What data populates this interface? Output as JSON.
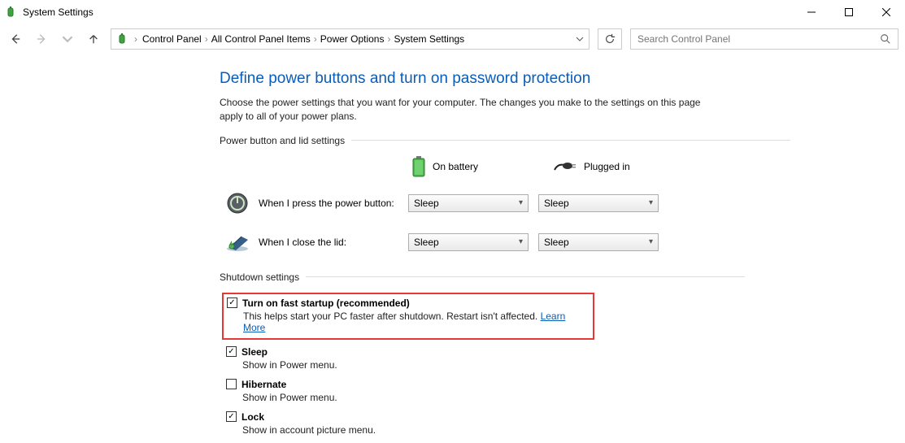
{
  "window": {
    "title": "System Settings"
  },
  "breadcrumb": {
    "items": [
      "Control Panel",
      "All Control Panel Items",
      "Power Options",
      "System Settings"
    ]
  },
  "search": {
    "placeholder": "Search Control Panel"
  },
  "page": {
    "heading": "Define power buttons and turn on password protection",
    "intro": "Choose the power settings that you want for your computer. The changes you make to the settings on this page apply to all of your power plans."
  },
  "sections": {
    "power_lid": "Power button and lid settings",
    "shutdown": "Shutdown settings"
  },
  "columns": {
    "battery": "On battery",
    "plugged": "Plugged in"
  },
  "rows": {
    "power_button": {
      "label": "When I press the power button:",
      "battery": "Sleep",
      "plugged": "Sleep"
    },
    "close_lid": {
      "label": "When I close the lid:",
      "battery": "Sleep",
      "plugged": "Sleep"
    }
  },
  "shutdown": {
    "fast_startup": {
      "label": "Turn on fast startup (recommended)",
      "desc": "This helps start your PC faster after shutdown. Restart isn't affected. ",
      "link": "Learn More",
      "checked": true
    },
    "sleep": {
      "label": "Sleep",
      "desc": "Show in Power menu.",
      "checked": true
    },
    "hibernate": {
      "label": "Hibernate",
      "desc": "Show in Power menu.",
      "checked": false
    },
    "lock": {
      "label": "Lock",
      "desc": "Show in account picture menu.",
      "checked": true
    }
  }
}
